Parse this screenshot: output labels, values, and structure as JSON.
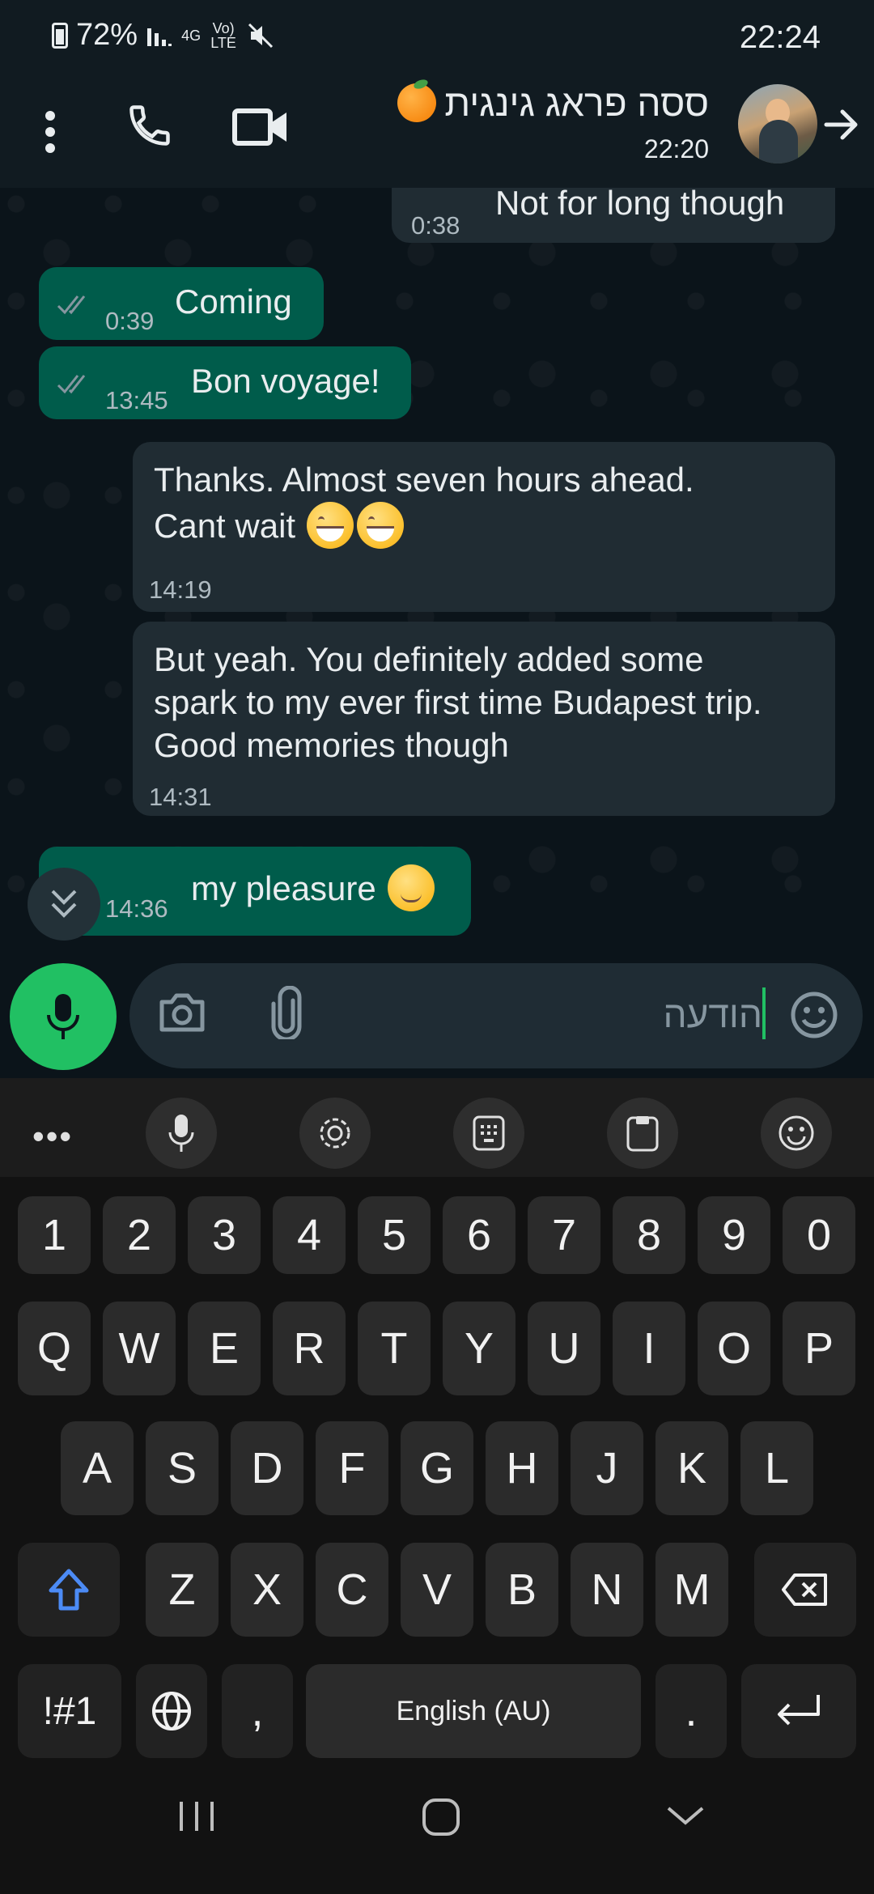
{
  "status_bar": {
    "battery": "72%",
    "network_4g": "4G",
    "volte": "Vo) LTE",
    "time": "22:24"
  },
  "header": {
    "contact_name": "ססה פראג גינגית",
    "last_seen": "22:20"
  },
  "messages": [
    {
      "direction": "incoming",
      "text": "Not for long though",
      "time": "0:38"
    },
    {
      "direction": "outgoing",
      "text": "Coming",
      "time": "0:39"
    },
    {
      "direction": "outgoing",
      "text": "Bon voyage!",
      "time": "13:45"
    },
    {
      "direction": "incoming",
      "lines": [
        "Thanks. Almost seven hours ahead.",
        "Cant wait"
      ],
      "time": "14:19"
    },
    {
      "direction": "incoming",
      "lines": [
        "But yeah. You definitely added some",
        "spark to my ever first time Budapest trip.",
        "Good memories though"
      ],
      "time": "14:31"
    },
    {
      "direction": "outgoing",
      "text": "my pleasure",
      "time": "14:36"
    }
  ],
  "composer": {
    "placeholder": "הודעה"
  },
  "keyboard": {
    "row_numbers": [
      "1",
      "2",
      "3",
      "4",
      "5",
      "6",
      "7",
      "8",
      "9",
      "0"
    ],
    "row_1": [
      "Q",
      "W",
      "E",
      "R",
      "T",
      "Y",
      "U",
      "I",
      "O",
      "P"
    ],
    "row_2": [
      "A",
      "S",
      "D",
      "F",
      "G",
      "H",
      "J",
      "K",
      "L"
    ],
    "row_3": [
      "Z",
      "X",
      "C",
      "V",
      "B",
      "N",
      "M"
    ],
    "symbols_label": "!#1",
    "comma_label": ",",
    "space_label": "English (AU)",
    "period_label": "."
  },
  "colors": {
    "accent_green": "#21c063",
    "outgoing_bubble": "#005c4b",
    "incoming_bubble": "#202c33",
    "shift_blue": "#4c8bf5"
  }
}
